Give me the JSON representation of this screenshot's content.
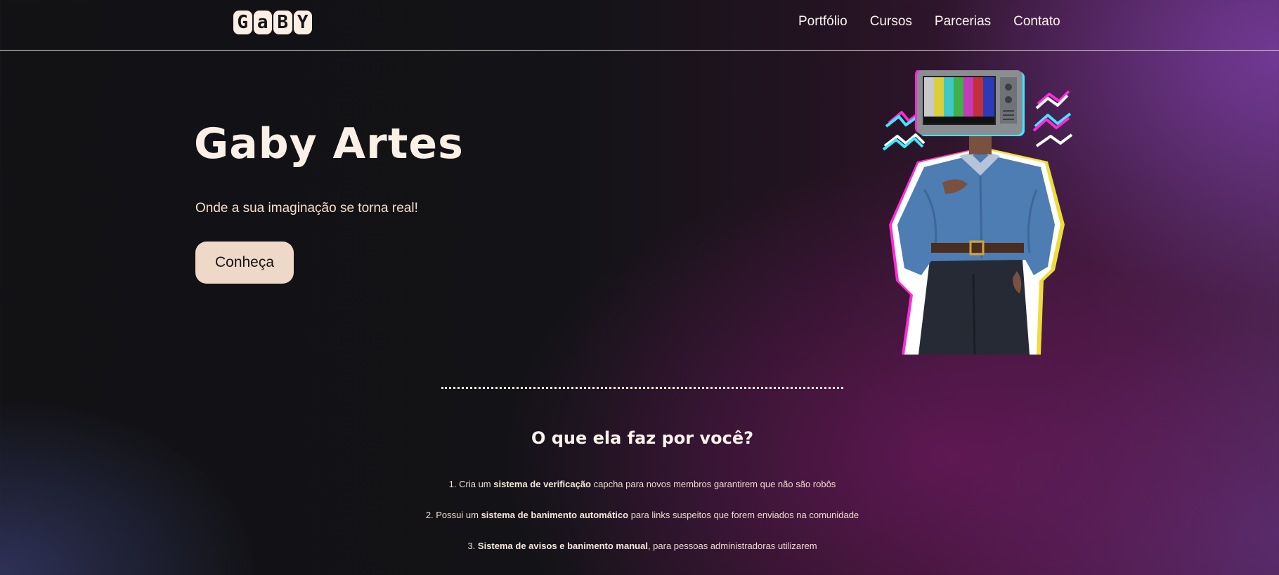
{
  "header": {
    "logo_letters": [
      "G",
      "a",
      "B",
      "Y"
    ],
    "nav": [
      "Portfólio",
      "Cursos",
      "Parcerias",
      "Contato"
    ]
  },
  "hero": {
    "title": "Gaby Artes",
    "subtitle": "Onde a sua imaginação se torna real!",
    "cta_label": "Conheça"
  },
  "section": {
    "title": "O que ela faz por você?",
    "features": [
      {
        "prefix": "1. Cria um ",
        "bold": "sistema de verificação",
        "suffix": " capcha para novos membros garantirem que não são robôs"
      },
      {
        "prefix": "2. Possui um ",
        "bold": "sistema de banimento automático",
        "suffix": " para links suspeitos que forem enviados na comunidade"
      },
      {
        "prefix": "3. ",
        "bold": "Sistema de avisos e banimento manual",
        "suffix": ", para pessoas administradoras utilizarem"
      }
    ]
  },
  "colors": {
    "accent": "#eed9c8",
    "text": "#fbf0e6",
    "background_dark": "#121215",
    "background_purple": "#4a2450"
  },
  "icons": {
    "hero_illustration": "tv-head-character-illustration"
  }
}
